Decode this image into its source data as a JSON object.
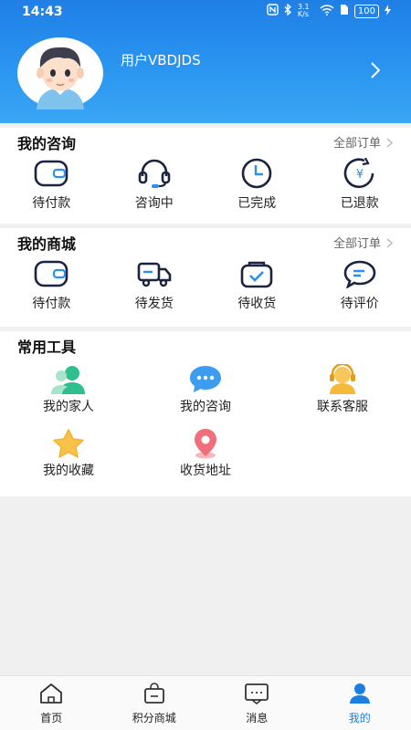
{
  "status_bar": {
    "time": "14:43",
    "signal_text": "3.1 K/s",
    "battery": "100"
  },
  "profile": {
    "username": "用户VBDJDS"
  },
  "consult": {
    "title": "我的咨询",
    "all_orders": "全部订单",
    "items": [
      {
        "label": "待付款",
        "icon": "wallet-icon"
      },
      {
        "label": "咨询中",
        "icon": "headset-icon"
      },
      {
        "label": "已完成",
        "icon": "clock-icon"
      },
      {
        "label": "已退款",
        "icon": "refund-icon"
      }
    ]
  },
  "mall": {
    "title": "我的商城",
    "all_orders": "全部订单",
    "items": [
      {
        "label": "待付款",
        "icon": "wallet-icon"
      },
      {
        "label": "待发货",
        "icon": "truck-icon"
      },
      {
        "label": "待收货",
        "icon": "package-check-icon"
      },
      {
        "label": "待评价",
        "icon": "chat-bubble-icon"
      }
    ]
  },
  "tools": {
    "title": "常用工具",
    "items": [
      {
        "label": "我的家人",
        "icon": "family-icon"
      },
      {
        "label": "我的咨询",
        "icon": "consult-bubble-icon"
      },
      {
        "label": "联系客服",
        "icon": "customer-service-icon"
      },
      {
        "label": "我的收藏",
        "icon": "star-icon"
      },
      {
        "label": "收货地址",
        "icon": "location-pin-icon"
      }
    ]
  },
  "bottom_nav": [
    {
      "label": "首页",
      "icon": "home-icon"
    },
    {
      "label": "积分商城",
      "icon": "shopping-bag-icon"
    },
    {
      "label": "消息",
      "icon": "message-icon"
    },
    {
      "label": "我的",
      "icon": "user-icon",
      "active": true
    }
  ],
  "colors": {
    "header": "#2a8fee",
    "accent": "#1a7fe0"
  }
}
